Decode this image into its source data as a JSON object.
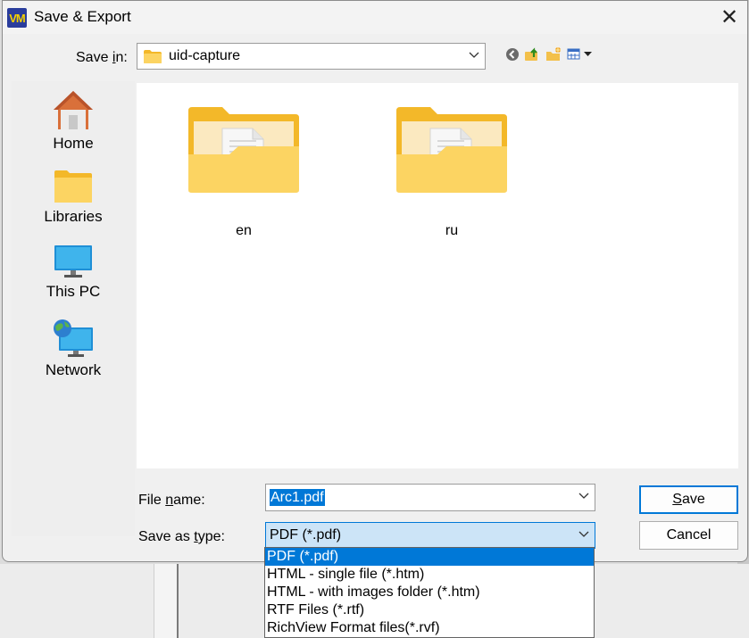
{
  "window": {
    "title": "Save & Export",
    "app_icon_text": "VM",
    "close_glyph": "✕"
  },
  "save_in": {
    "label_prefix": "Save ",
    "label_underline": "i",
    "label_suffix": "n:",
    "folder": "uid-capture"
  },
  "toolbar": {
    "icons": [
      "back-icon",
      "up-folder-icon",
      "new-folder-icon",
      "view-menu-icon"
    ]
  },
  "places": [
    {
      "label": "Home",
      "icon": "home-icon"
    },
    {
      "label": "Libraries",
      "icon": "libraries-icon"
    },
    {
      "label": "This PC",
      "icon": "this-pc-icon"
    },
    {
      "label": "Network",
      "icon": "network-icon"
    }
  ],
  "files": [
    {
      "name": "en",
      "icon": "folder-icon"
    },
    {
      "name": "ru",
      "icon": "folder-icon"
    }
  ],
  "file_name": {
    "label_prefix": "File ",
    "label_underline": "n",
    "label_suffix": "ame:",
    "value": "Arc1.pdf"
  },
  "save_as_type": {
    "label_prefix": "Save as ",
    "label_underline": "t",
    "label_suffix": "ype:",
    "value": "PDF (*.pdf)",
    "options": [
      "PDF (*.pdf)",
      "HTML - single file (*.htm)",
      "HTML - with images folder (*.htm)",
      "RTF Files (*.rtf)",
      "RichView Format files(*.rvf)"
    ],
    "selected_index": 0
  },
  "buttons": {
    "save_underline": "S",
    "save_rest": "ave",
    "cancel": "Cancel"
  },
  "colors": {
    "accent": "#0078d7",
    "folder": "#f7c948"
  }
}
